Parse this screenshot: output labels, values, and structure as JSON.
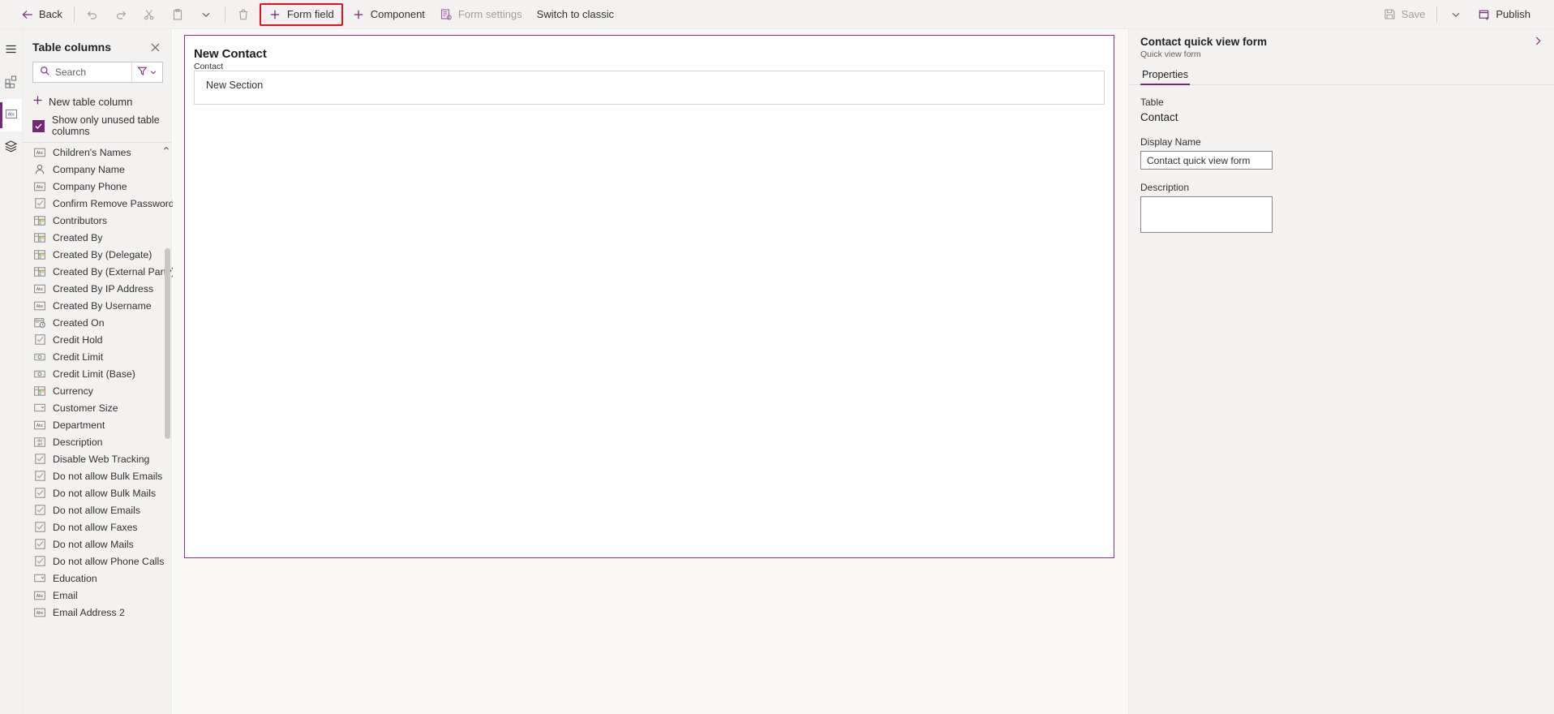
{
  "commandbar": {
    "back_label": "Back",
    "undo_title": "Undo",
    "redo_title": "Redo",
    "cut_title": "Cut",
    "paste_title": "Paste",
    "more_title": "More",
    "delete_title": "Delete",
    "form_field_label": "Form field",
    "component_label": "Component",
    "form_settings_label": "Form settings",
    "switch_classic_label": "Switch to classic",
    "save_label": "Save",
    "save_chevron_title": "Save options",
    "publish_label": "Publish",
    "highlight_color": "#e81123",
    "accent_color": "#742774"
  },
  "rail": {
    "items": [
      {
        "name": "hamburger-icon",
        "title": "Expand navigation",
        "active": false
      },
      {
        "name": "components-icon",
        "title": "Components",
        "active": false
      },
      {
        "name": "table-columns-icon",
        "title": "Table columns",
        "active": true
      },
      {
        "name": "layers-icon",
        "title": "Tree view",
        "active": false
      }
    ]
  },
  "columns_panel": {
    "title": "Table columns",
    "close_title": "Close",
    "search": {
      "placeholder": "Search",
      "value": "",
      "icon": "search-icon",
      "filter_icon": "filter-icon",
      "filter_chevron": "chevron-down-icon"
    },
    "new_column_label": "New table column",
    "show_unused_label": "Show only unused table columns",
    "show_unused_checked": true,
    "items": [
      {
        "label": "Children's Names",
        "icon": "text-icon"
      },
      {
        "label": "Company Name",
        "icon": "person-icon"
      },
      {
        "label": "Company Phone",
        "icon": "text-icon"
      },
      {
        "label": "Confirm Remove Password",
        "icon": "checkbox-icon"
      },
      {
        "label": "Contributors",
        "icon": "lookup-icon"
      },
      {
        "label": "Created By",
        "icon": "lookup-icon"
      },
      {
        "label": "Created By (Delegate)",
        "icon": "lookup-icon"
      },
      {
        "label": "Created By (External Party)",
        "icon": "lookup-icon"
      },
      {
        "label": "Created By IP Address",
        "icon": "text-icon"
      },
      {
        "label": "Created By Username",
        "icon": "text-icon"
      },
      {
        "label": "Created On",
        "icon": "datetime-icon"
      },
      {
        "label": "Credit Hold",
        "icon": "checkbox-icon"
      },
      {
        "label": "Credit Limit",
        "icon": "currency-icon"
      },
      {
        "label": "Credit Limit (Base)",
        "icon": "currency-icon"
      },
      {
        "label": "Currency",
        "icon": "lookup-icon"
      },
      {
        "label": "Customer Size",
        "icon": "choice-icon"
      },
      {
        "label": "Department",
        "icon": "text-icon"
      },
      {
        "label": "Description",
        "icon": "multiline-text-icon"
      },
      {
        "label": "Disable Web Tracking",
        "icon": "checkbox-icon"
      },
      {
        "label": "Do not allow Bulk Emails",
        "icon": "checkbox-icon"
      },
      {
        "label": "Do not allow Bulk Mails",
        "icon": "checkbox-icon"
      },
      {
        "label": "Do not allow Emails",
        "icon": "checkbox-icon"
      },
      {
        "label": "Do not allow Faxes",
        "icon": "checkbox-icon"
      },
      {
        "label": "Do not allow Mails",
        "icon": "checkbox-icon"
      },
      {
        "label": "Do not allow Phone Calls",
        "icon": "checkbox-icon"
      },
      {
        "label": "Education",
        "icon": "choice-icon"
      },
      {
        "label": "Email",
        "icon": "text-icon"
      },
      {
        "label": "Email Address 2",
        "icon": "text-icon"
      }
    ]
  },
  "canvas": {
    "form_title": "New Contact",
    "form_subtitle": "Contact",
    "section_label": "New Section",
    "selection_color": "#8a2f8a"
  },
  "properties": {
    "title": "Contact quick view form",
    "subtitle": "Quick view form",
    "collapse_icon": "chevron-right-icon",
    "tabs": [
      {
        "label": "Properties",
        "active": true
      }
    ],
    "table_label": "Table",
    "table_value": "Contact",
    "display_name_label": "Display Name",
    "display_name_value": "Contact quick view form",
    "description_label": "Description",
    "description_value": ""
  }
}
